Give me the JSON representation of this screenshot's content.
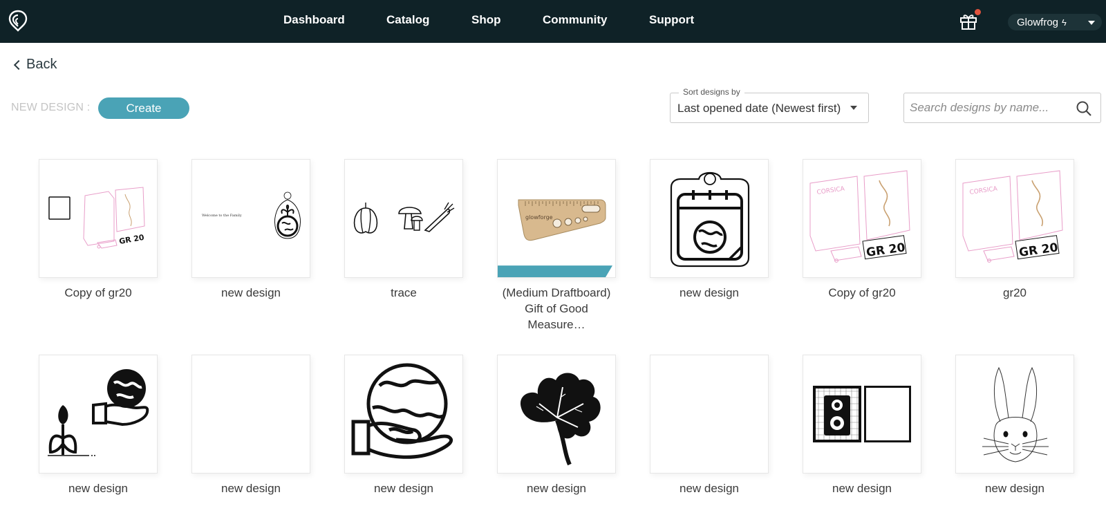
{
  "nav": {
    "items": [
      "Dashboard",
      "Catalog",
      "Shop",
      "Community",
      "Support"
    ],
    "user_name": "Glowfrog",
    "bolt": "ϟ"
  },
  "back_label": "Back",
  "new_design": {
    "label": "NEW DESIGN :",
    "create_label": "Create"
  },
  "sort": {
    "legend": "Sort designs by",
    "value": "Last opened date (Newest first)"
  },
  "search": {
    "placeholder": "Search designs by name..."
  },
  "designs": [
    {
      "title": "Copy of gr20",
      "thumb": "gr20-box-pink"
    },
    {
      "title": "new design",
      "thumb": "welcome-family-tag"
    },
    {
      "title": "trace",
      "thumb": "vegetables"
    },
    {
      "title": "(Medium Draftboard) Gift of Good Measure…",
      "thumb": "ruler-gift",
      "badge": true
    },
    {
      "title": "new design",
      "thumb": "calendar-globe-tag"
    },
    {
      "title": "Copy of gr20",
      "thumb": "gr20-pink"
    },
    {
      "title": "gr20",
      "thumb": "gr20-pink"
    },
    {
      "title": "new design",
      "thumb": "tulip-globe-hand"
    },
    {
      "title": "new design",
      "thumb": "blank"
    },
    {
      "title": "new design",
      "thumb": "globe-hand"
    },
    {
      "title": "new design",
      "thumb": "clover"
    },
    {
      "title": "new design",
      "thumb": "blank"
    },
    {
      "title": "new design",
      "thumb": "camera-box"
    },
    {
      "title": "new design",
      "thumb": "bunny"
    }
  ],
  "thumb_texts": {
    "welcome": "Welcome to the Family",
    "gr20": "GR 20",
    "corsica": "CORSICA",
    "ruler_brand": "glowforge"
  },
  "colors": {
    "topbar": "#0f2227",
    "accent": "#4aa3b6",
    "pink_line": "#e89cc8",
    "gift_dot": "#e0533d"
  },
  "icons": {
    "logo": "glowforge-logo-icon",
    "gift": "gift-icon",
    "search": "search-icon",
    "back": "chevron-left-icon",
    "sort": "caret-down-icon"
  }
}
